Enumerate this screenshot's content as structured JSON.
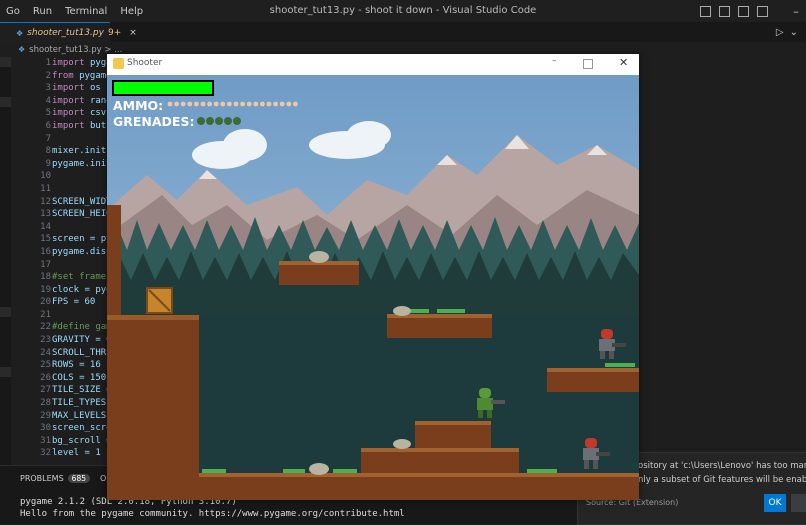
{
  "menu": [
    "Go",
    "Run",
    "Terminal",
    "Help"
  ],
  "window_title": "shooter_tut13.py - shoot it down - Visual Studio Code",
  "editor": {
    "tab": {
      "filename": "shooter_tut13.py",
      "badge": "9+",
      "close": "×"
    },
    "breadcrumb": "shooter_tut13.py > ...",
    "line_numbers": [
      "1",
      "2",
      "3",
      "4",
      "5",
      "6",
      "7",
      "8",
      "9",
      "10",
      "11",
      "12",
      "13",
      "14",
      "15",
      "16",
      "17",
      "18",
      "19",
      "20",
      "21",
      "22",
      "23",
      "24",
      "25",
      "26",
      "27",
      "28",
      "29",
      "30",
      "31",
      "32"
    ],
    "lines": [
      {
        "kw": "import ",
        "rest": "pyga"
      },
      {
        "kw": "from ",
        "rest": "pygame"
      },
      {
        "kw": "import ",
        "rest": "os"
      },
      {
        "kw": "import ",
        "rest": "rando"
      },
      {
        "kw": "import ",
        "rest": "csv"
      },
      {
        "kw": "import ",
        "rest": "butt"
      },
      {
        "kw": "",
        "rest": ""
      },
      {
        "kw": "",
        "rest": "mixer.init("
      },
      {
        "kw": "",
        "rest": "pygame.init"
      },
      {
        "kw": "",
        "rest": ""
      },
      {
        "kw": "",
        "rest": ""
      },
      {
        "kw": "",
        "rest": "SCREEN_WIDT"
      },
      {
        "kw": "",
        "rest": "SCREEN_HEIG"
      },
      {
        "kw": "",
        "rest": ""
      },
      {
        "kw": "",
        "rest": "screen = py"
      },
      {
        "kw": "",
        "rest": "pygame.disp"
      },
      {
        "kw": "",
        "rest": ""
      },
      {
        "kw": "",
        "rest": "#set framer",
        "comment": true
      },
      {
        "kw": "",
        "rest": "clock = pyg"
      },
      {
        "kw": "",
        "rest": "FPS = 60"
      },
      {
        "kw": "",
        "rest": ""
      },
      {
        "kw": "",
        "rest": "#define gam",
        "comment": true
      },
      {
        "kw": "",
        "rest": "GRAVITY = 0"
      },
      {
        "kw": "",
        "rest": "SCROLL_THRE"
      },
      {
        "kw": "",
        "rest": "ROWS = 16"
      },
      {
        "kw": "",
        "rest": "COLS = 150"
      },
      {
        "kw": "",
        "rest": "TILE_SIZE ="
      },
      {
        "kw": "",
        "rest": "TILE_TYPES"
      },
      {
        "kw": "",
        "rest": "MAX_LEVELS"
      },
      {
        "kw": "",
        "rest": "screen_scro"
      },
      {
        "kw": "",
        "rest": "bg_scroll ="
      },
      {
        "kw": "",
        "rest": "level = 1"
      }
    ]
  },
  "panel": {
    "tabs": [
      {
        "label": "PROBLEMS",
        "badge": "685"
      },
      {
        "label": "OU"
      }
    ],
    "terminal": [
      "pygame 2.1.2 (SDL 2.0.18, Python 3.10.7)",
      "Hello from the pygame community. https://www.pygame.org/contribute.html"
    ]
  },
  "notification": {
    "line1": "ository at 'c:\\Users\\Lenovo' has too many ac",
    "line2": "nly a subset of Git features will be enabled.",
    "source": "Source: Git (Extension)",
    "ok": "OK"
  },
  "game": {
    "window_title": "Shooter",
    "hud": {
      "ammo_label": "AMMO:",
      "grenades_label": "GRENADES:",
      "ammo_count": 20,
      "grenade_count": 5,
      "health": 1.0
    },
    "colors": {
      "health": "#00ff00",
      "sky": "#7ea6c9",
      "dirt": "#8b4a22",
      "grass": "#3fa43f",
      "forest": "#1f3d3a",
      "player": "#5a9a3a",
      "enemy": "#c0392b"
    }
  }
}
